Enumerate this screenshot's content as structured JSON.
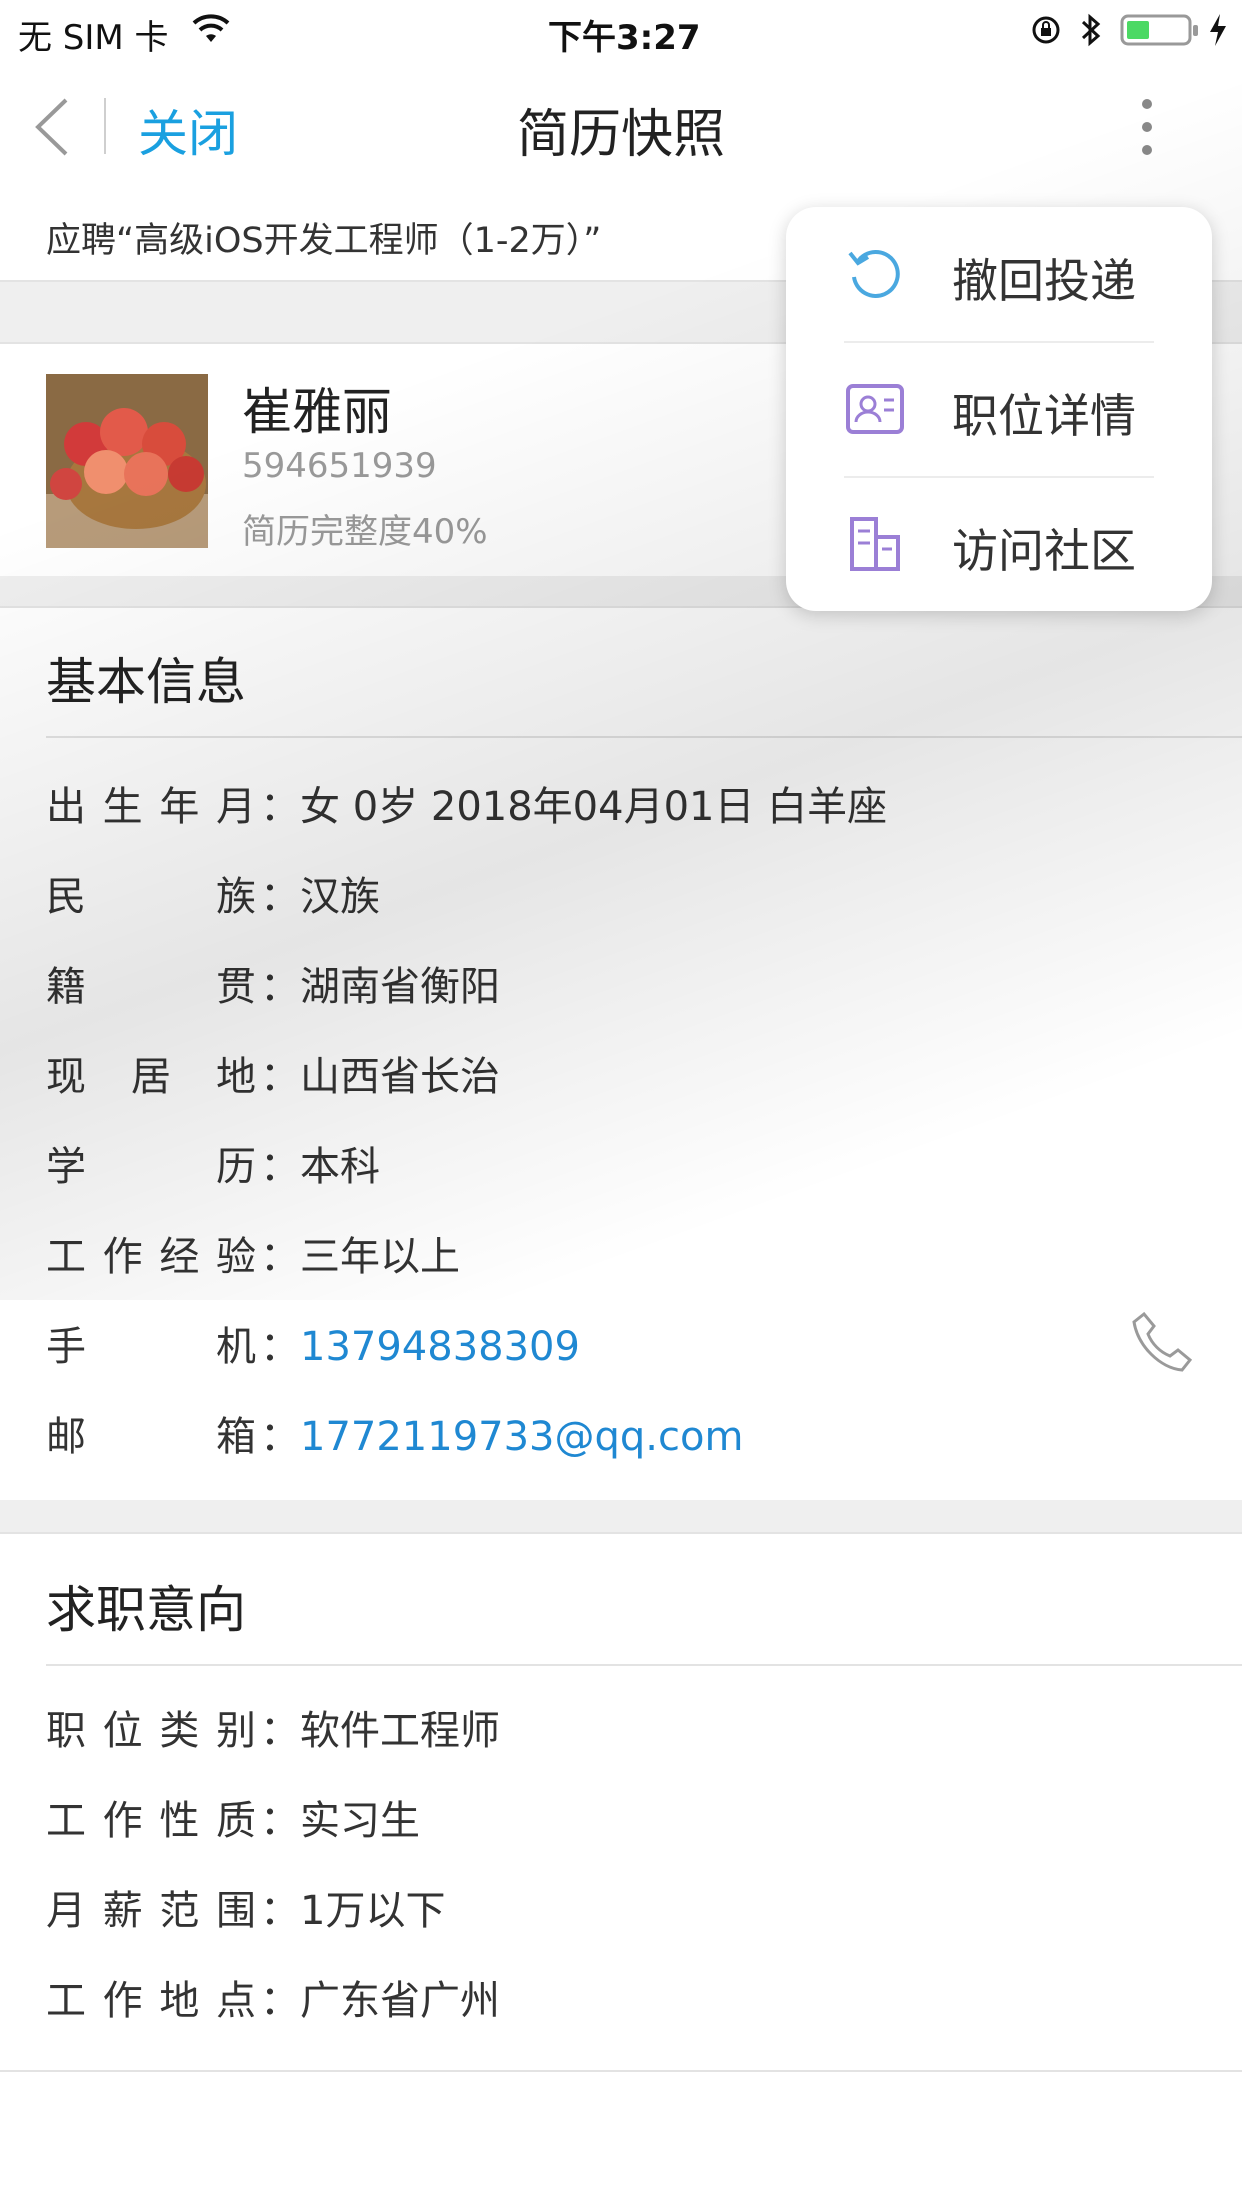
{
  "status_bar": {
    "carrier": "无 SIM 卡",
    "time": "下午3:27",
    "icons": [
      "wifi-icon",
      "orientation-lock-icon",
      "bluetooth-icon",
      "battery-icon",
      "charging-icon"
    ]
  },
  "nav": {
    "back_icon": "chevron-left-icon",
    "close_label": "关闭",
    "title": "简历快照",
    "more_icon": "more-vertical-icon"
  },
  "apply_text": "应聘“高级iOS开发工程师（1-2万）”",
  "profile": {
    "name": "崔雅丽",
    "id": "594651939",
    "completeness": "简历完整度40%"
  },
  "basic_info": {
    "title": "基本信息",
    "rows": [
      {
        "label": "出生年月",
        "value": "女 0岁 2018年04月01日 白羊座"
      },
      {
        "label": "民族",
        "value": "汉族"
      },
      {
        "label": "籍贯",
        "value": "湖南省衡阳"
      },
      {
        "label": "现居地",
        "value": "山西省长治"
      },
      {
        "label": "学历",
        "value": "本科"
      },
      {
        "label": "工作经验",
        "value": "三年以上"
      },
      {
        "label": "手机",
        "value": "13794838309"
      },
      {
        "label": "邮箱",
        "value": "1772119733@qq.com"
      }
    ],
    "phone_icon": "phone-icon"
  },
  "job_intent": {
    "title": "求职意向",
    "rows": [
      {
        "label": "职位类别",
        "value": "软件工程师"
      },
      {
        "label": "工作性质",
        "value": "实习生"
      },
      {
        "label": "月薪范围",
        "value": "1万以下"
      },
      {
        "label": "工作地点",
        "value": "广东省广州"
      }
    ]
  },
  "menu": {
    "items": [
      {
        "label": "撤回投递",
        "icon": "undo-icon"
      },
      {
        "label": "职位详情",
        "icon": "id-card-icon"
      },
      {
        "label": "访问社区",
        "icon": "building-icon"
      }
    ]
  },
  "colors": {
    "accent": "#1aa0e0",
    "link": "#1f88d2",
    "menu_icon_purple": "#9b7fd6",
    "undo_blue": "#4aa8e0"
  }
}
